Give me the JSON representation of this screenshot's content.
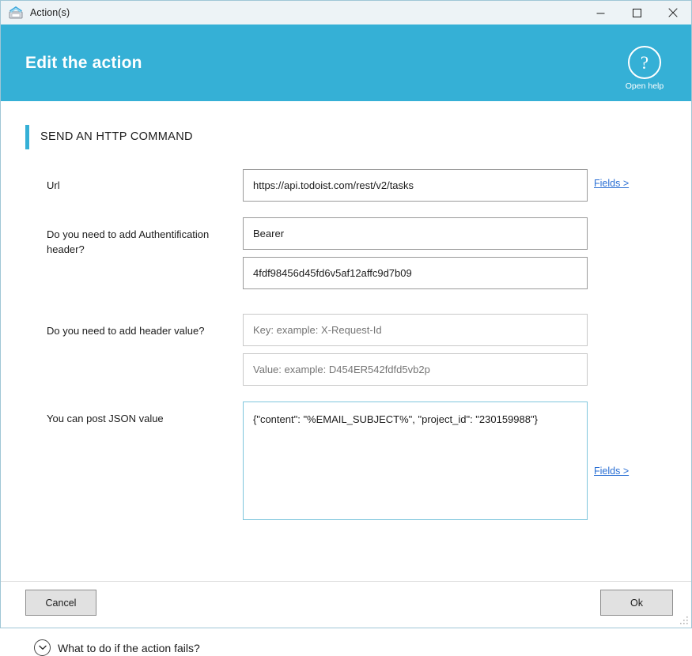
{
  "window": {
    "title": "Action(s)",
    "app_icon": "fax-machine-icon",
    "controls": {
      "minimize": "minimize-icon",
      "maximize": "maximize-icon",
      "close": "close-icon"
    }
  },
  "header": {
    "title": "Edit the action",
    "help_glyph": "?",
    "help_label": "Open help",
    "background_color": "#35b0d6"
  },
  "section": {
    "title": "SEND AN HTTP COMMAND",
    "accent_color": "#35b0d6"
  },
  "fields": {
    "url": {
      "label": "Url",
      "value": "https://api.todoist.com/rest/v2/tasks",
      "placeholder": "",
      "link": "Fields >"
    },
    "auth_header": {
      "label": "Do you need to add Authentification header?",
      "scheme_value": "Bearer",
      "scheme_placeholder": "",
      "token_value": "4fdf98456d45fd6v5af12affc9d7b09",
      "token_placeholder": ""
    },
    "header_value": {
      "label": "Do you need to add header value?",
      "key_value": "",
      "key_placeholder": "Key: example: X-Request-Id",
      "value_value": "",
      "value_placeholder": "Value: example: D454ER542fdfd5vb2p"
    },
    "json": {
      "label": "You can post JSON value",
      "value": "{\"content\": \"%EMAIL_SUBJECT%\", \"project_id\": \"230159988\"}",
      "placeholder": "",
      "link": "Fields >"
    }
  },
  "collapse": {
    "label": "What to do if the action fails?",
    "icon": "chevron-down-circle-icon"
  },
  "footer": {
    "cancel_label": "Cancel",
    "ok_label": "Ok"
  }
}
